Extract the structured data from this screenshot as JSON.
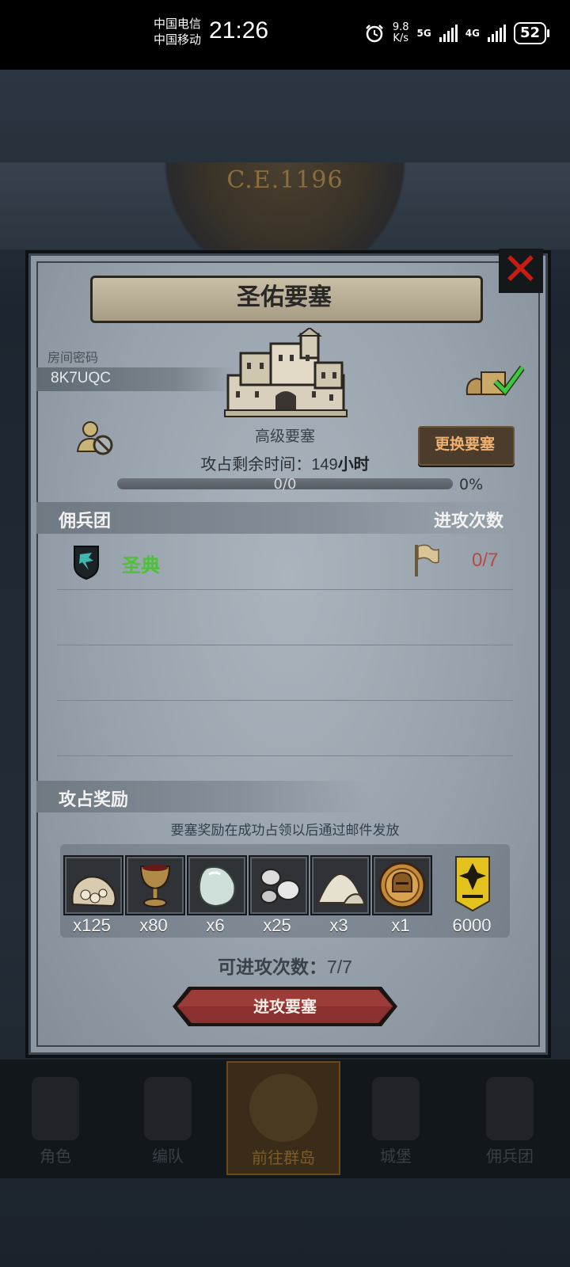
{
  "status_bar": {
    "carrier_1": "中国电信",
    "carrier_2": "中国移动",
    "time": "21:26",
    "speed_value": "9.8",
    "speed_unit": "K/s",
    "net_5g": "5G",
    "net_4g": "4G",
    "battery": "52"
  },
  "background": {
    "era": "C.E.1196",
    "nav": [
      "角色",
      "编队",
      "前往群岛",
      "城堡",
      "佣兵团"
    ]
  },
  "panel": {
    "title": "圣佑要塞",
    "room_label": "房间密码",
    "room_code": "8K7UQC",
    "fortress_level": "高级要塞",
    "change_button": "更换要塞",
    "time_left_label": "攻占剩余时间：",
    "time_left_value": "149",
    "time_left_unit": "小时",
    "progress_text": "0/0",
    "progress_percent": "0%",
    "progress_fraction": 0
  },
  "mercenary": {
    "header_left": "佣兵团",
    "header_right": "进攻次数",
    "rows": [
      {
        "name": "圣典",
        "count": "0/7"
      }
    ]
  },
  "rewards": {
    "title": "攻占奖励",
    "note": "要塞奖励在成功占领以后通过邮件发放",
    "items": [
      {
        "icon": "ore-bag-icon",
        "qty": "x125"
      },
      {
        "icon": "goblet-icon",
        "qty": "x80"
      },
      {
        "icon": "gem-stone-icon",
        "qty": "x6"
      },
      {
        "icon": "silver-ore-icon",
        "qty": "x25"
      },
      {
        "icon": "sand-pile-icon",
        "qty": "x3"
      },
      {
        "icon": "knight-helmet-coin-icon",
        "qty": "x1"
      },
      {
        "icon": "guild-badge-icon",
        "qty": "6000"
      }
    ]
  },
  "footer": {
    "available_label": "可进攻次数：",
    "available_value": "7/7",
    "attack_button": "进攻要塞"
  },
  "colors": {
    "guild_name": "#4ec03a",
    "attack_count": "#b84a42",
    "close_x": "#c41e14",
    "change_button_text": "#f0b070"
  }
}
